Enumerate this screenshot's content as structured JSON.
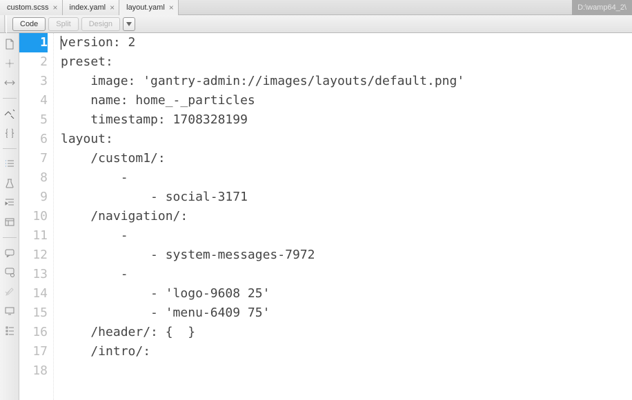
{
  "titlepath": "D:\\wamp64_2\\",
  "tabs": [
    {
      "label": "custom.scss",
      "active": false
    },
    {
      "label": "index.yaml",
      "active": false
    },
    {
      "label": "layout.yaml",
      "active": true
    }
  ],
  "viewmodes": {
    "code": "Code",
    "split": "Split",
    "design": "Design"
  },
  "editor": {
    "current_line": 1,
    "lines": [
      "version: 2",
      "preset:",
      "    image: 'gantry-admin://images/layouts/default.png'",
      "    name: home_-_particles",
      "    timestamp: 1708328199",
      "layout:",
      "    /custom1/:",
      "        -",
      "            - social-3171",
      "    /navigation/:",
      "        -",
      "            - system-messages-7972",
      "        -",
      "            - 'logo-9608 25'",
      "            - 'menu-6409 75'",
      "    /header/: {  }",
      "    /intro/:",
      ""
    ]
  }
}
